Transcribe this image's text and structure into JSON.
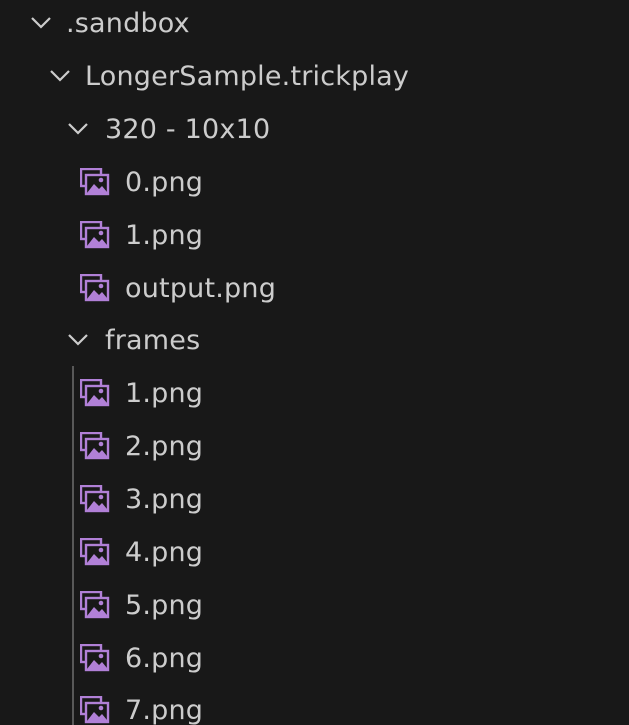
{
  "explorer": {
    "root": {
      "label": ".sandbox",
      "expanded": true,
      "children_folder": {
        "label": "LongerSample.trickplay",
        "expanded": true,
        "sub_a": {
          "label": "320 - 10x10",
          "expanded": true,
          "files": [
            "0.png",
            "1.png",
            "output.png"
          ]
        },
        "sub_b": {
          "label": "frames",
          "expanded": true,
          "files": [
            "1.png",
            "2.png",
            "3.png",
            "4.png",
            "5.png",
            "6.png",
            "7.png"
          ]
        }
      }
    }
  },
  "icons": {
    "folder_state": "chevron-down-icon",
    "file_type": "image-file-icon",
    "image_icon_color": "#b180d7",
    "chevron_color": "#cccccc"
  }
}
